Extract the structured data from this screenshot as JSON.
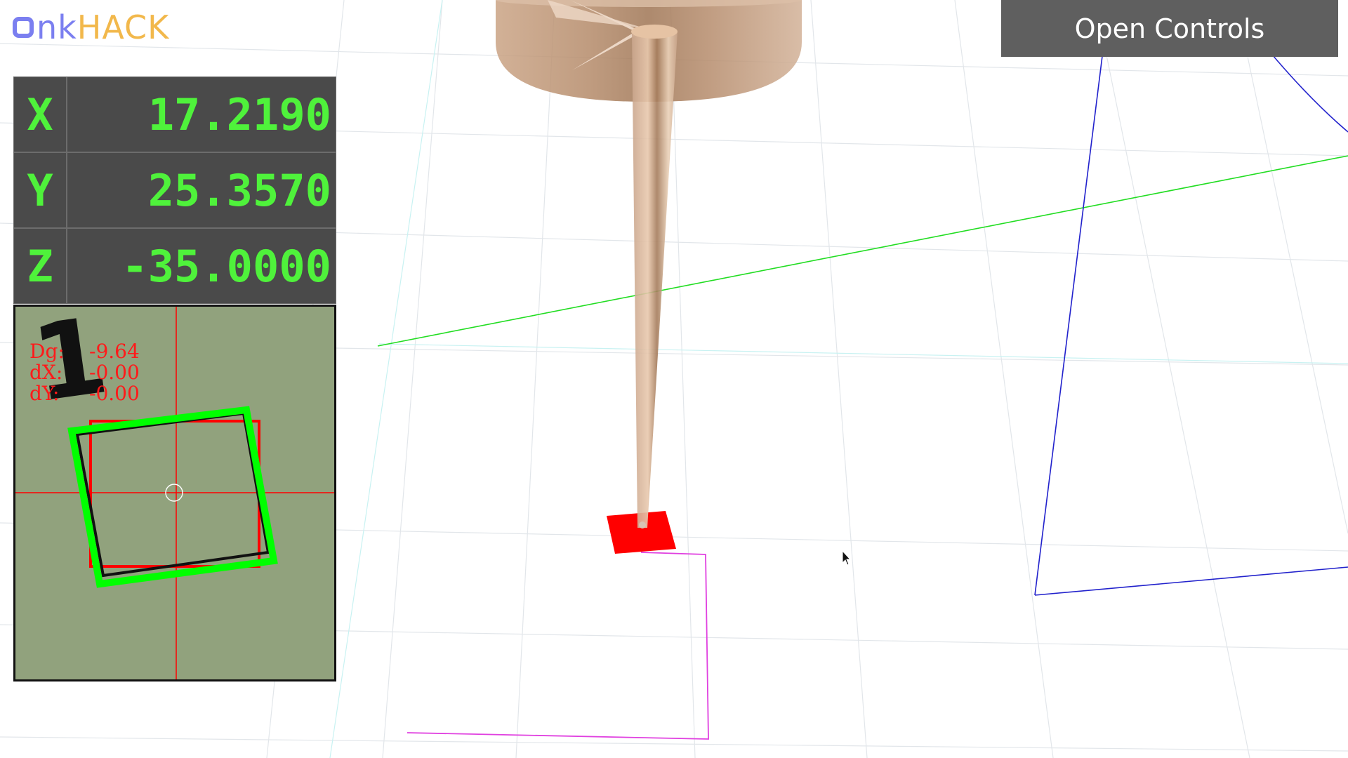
{
  "logo": {
    "prefix": "nk",
    "suffix": "HACK"
  },
  "controls_button": {
    "label": "Open Controls"
  },
  "coordinates": [
    {
      "axis": "X",
      "value": "17.2190"
    },
    {
      "axis": "Y",
      "value": "25.3570"
    },
    {
      "axis": "Z",
      "value": "-35.0000"
    }
  ],
  "camera": {
    "digit": "1",
    "overlay": [
      {
        "label": "Dg:",
        "value": "-9.64"
      },
      {
        "label": "dX:",
        "value": "-0.00"
      },
      {
        "label": "dY:",
        "value": "-0.00"
      }
    ]
  },
  "colors": {
    "readout_bg": "#4a4a4a",
    "readout_text": "#4ff23b",
    "button_bg": "#5f5f5f",
    "logo_purple": "#7b7ff0",
    "logo_orange": "#f2b84b",
    "target_red": "#ff0000",
    "camera_green": "#00ff00"
  },
  "icons": {
    "logo": "logo-ring-icon",
    "cursor": "mouse-pointer-icon"
  }
}
